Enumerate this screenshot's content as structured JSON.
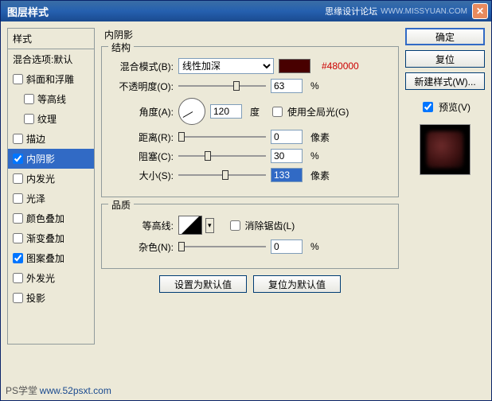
{
  "window": {
    "title": "图层样式",
    "forum": "思缘设计论坛",
    "url": "WWW.MISSYUAN.COM"
  },
  "sidebar": {
    "header": "样式",
    "blend_default": "混合选项:默认",
    "items": [
      {
        "label": "斜面和浮雕",
        "checked": false,
        "sub": false
      },
      {
        "label": "等高线",
        "checked": false,
        "sub": true
      },
      {
        "label": "纹理",
        "checked": false,
        "sub": true
      },
      {
        "label": "描边",
        "checked": false,
        "sub": false
      },
      {
        "label": "内阴影",
        "checked": true,
        "sub": false,
        "selected": true
      },
      {
        "label": "内发光",
        "checked": false,
        "sub": false
      },
      {
        "label": "光泽",
        "checked": false,
        "sub": false
      },
      {
        "label": "颜色叠加",
        "checked": false,
        "sub": false
      },
      {
        "label": "渐变叠加",
        "checked": false,
        "sub": false
      },
      {
        "label": "图案叠加",
        "checked": true,
        "sub": false
      },
      {
        "label": "外发光",
        "checked": false,
        "sub": false
      },
      {
        "label": "投影",
        "checked": false,
        "sub": false
      }
    ]
  },
  "panel": {
    "title": "内阴影",
    "structure_legend": "结构",
    "blend_label": "混合模式(B):",
    "blend_value": "线性加深",
    "color_hex": "#480000",
    "opacity_label": "不透明度(O):",
    "opacity_value": "63",
    "pct": "%",
    "angle_label": "角度(A):",
    "angle_value": "120",
    "degree": "度",
    "global_light": "使用全局光(G)",
    "distance_label": "距离(R):",
    "distance_value": "0",
    "px": "像素",
    "choke_label": "阻塞(C):",
    "choke_value": "30",
    "size_label": "大小(S):",
    "size_value": "133",
    "quality_legend": "品质",
    "contour_label": "等高线:",
    "antialias": "消除锯齿(L)",
    "noise_label": "杂色(N):",
    "noise_value": "0",
    "set_default": "设置为默认值",
    "reset_default": "复位为默认值"
  },
  "buttons": {
    "ok": "确定",
    "cancel": "复位",
    "new_style": "新建样式(W)...",
    "preview": "预览(V)"
  },
  "footer": {
    "badge": "PS学堂",
    "site": "www.52psxt.com"
  }
}
